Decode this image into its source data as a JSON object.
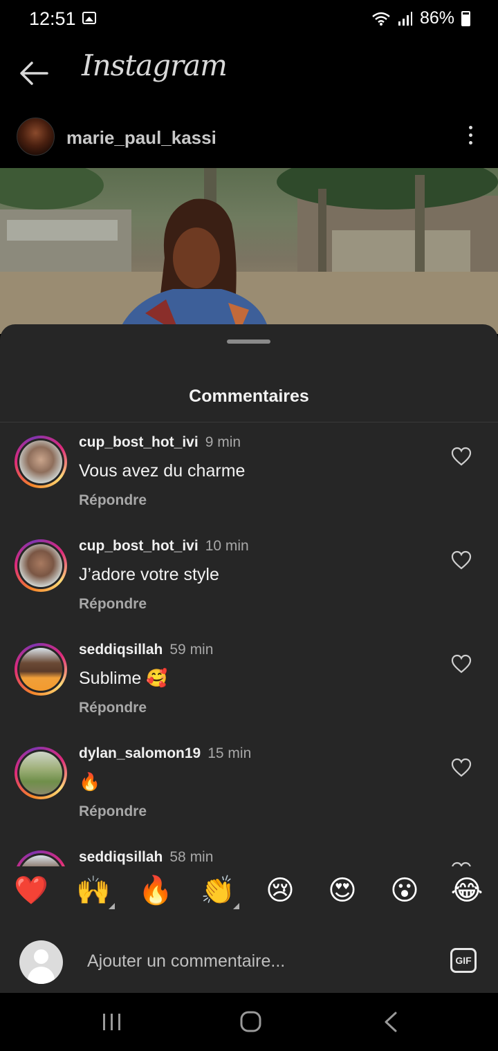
{
  "status_bar": {
    "time": "12:51",
    "battery": "86%"
  },
  "header": {
    "app_title": "Instagram"
  },
  "post": {
    "username": "marie_paul_kassi"
  },
  "sheet": {
    "title": "Commentaires",
    "comments": [
      {
        "username": "cup_bost_hot_ivi",
        "time": "9 min",
        "text": "Vous avez du charme",
        "reply_label": "Répondre"
      },
      {
        "username": "cup_bost_hot_ivi",
        "time": "10 min",
        "text": "J’adore votre style",
        "reply_label": "Répondre"
      },
      {
        "username": "seddiqsillah",
        "time": "59 min",
        "text": "Sublime 🥰",
        "reply_label": "Répondre"
      },
      {
        "username": "dylan_salomon19",
        "time": "15 min",
        "text": "🔥",
        "reply_label": "Répondre"
      },
      {
        "username": "seddiqsillah",
        "time": "58 min",
        "text": "",
        "reply_label": ""
      }
    ]
  },
  "emoji_bar": [
    "❤️",
    "🙌",
    "🔥",
    "👏",
    "😢",
    "😍",
    "😮",
    "😂"
  ],
  "composer": {
    "placeholder": "Ajouter un commentaire...",
    "gif_label": "GIF"
  }
}
